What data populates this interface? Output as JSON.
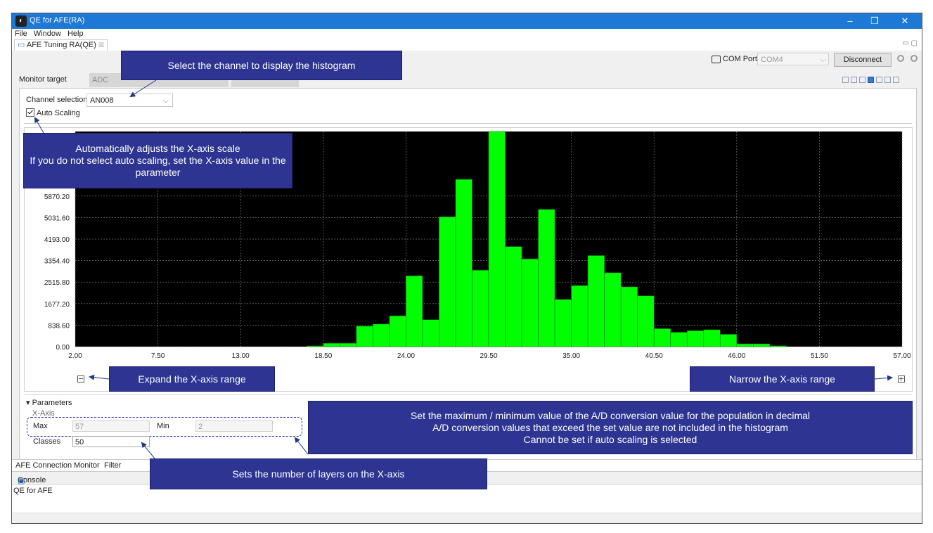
{
  "window": {
    "title": "QE for AFE(RA)",
    "app_icon": "qe-app-icon"
  },
  "menu": [
    "File",
    "Window",
    "Help"
  ],
  "editor_tab": {
    "label": "AFE Tuning RA(QE)",
    "close": "☒"
  },
  "com": {
    "label": "COM Port:",
    "value": "COM4",
    "disconnect_label": "Disconnect"
  },
  "monitor": {
    "label": "Monitor target",
    "target_value": "ADC"
  },
  "channel": {
    "label": "Channel selection",
    "value": "AN008"
  },
  "auto_scaling": {
    "label": "Auto Scaling",
    "checked": true
  },
  "chart_data": {
    "type": "bar",
    "title": "",
    "xlabel": "",
    "ylabel": "",
    "x_ticks": [
      "2.00",
      "7.50",
      "13.00",
      "18.50",
      "24.00",
      "29.50",
      "35.00",
      "40.50",
      "46.00",
      "51.50",
      "57.00"
    ],
    "y_ticks": [
      "0.00",
      "838.60",
      "1677.20",
      "2515.80",
      "3354.40",
      "4193.00",
      "5031.60",
      "5870.20"
    ],
    "xlim": [
      2,
      57
    ],
    "ylim": [
      0,
      8386
    ],
    "bin_width": 1.1,
    "bin_start": 2,
    "values": [
      0,
      0,
      0,
      0,
      0,
      0,
      0,
      0,
      0,
      0,
      0,
      0,
      0,
      0,
      30,
      130,
      130,
      800,
      880,
      1200,
      2760,
      1050,
      5060,
      6520,
      2980,
      8386,
      3900,
      3420,
      5350,
      1840,
      2380,
      3550,
      2880,
      2330,
      1980,
      700,
      560,
      620,
      660,
      480,
      110,
      110,
      35,
      0,
      0,
      0,
      0,
      0,
      0,
      0
    ],
    "bar_color": "#00ff00",
    "background": "#000000",
    "grid": true
  },
  "zoom": {
    "minus_icon": "zoom-out-icon",
    "plus_icon": "zoom-in-icon"
  },
  "params": {
    "heading": "Parameters",
    "xaxis_label": "X-Axis",
    "max_label": "Max",
    "max_value": "57",
    "min_label": "Min",
    "min_value": "2",
    "classes_label": "Classes",
    "classes_value": "50"
  },
  "bottom_tabs": [
    "AFE Connection",
    "Monitor",
    "Filter"
  ],
  "console": {
    "title": "Console",
    "text": "QE for AFE"
  },
  "callouts": {
    "channel": "Select the channel to display the histogram",
    "auto": "Automatically adjusts the X-axis scale\nIf you do not select auto scaling, set the X-axis value in the parameter",
    "expand": "Expand the X-axis range",
    "narrow": "Narrow the X-axis range",
    "maxmin": "Set the maximum / minimum value of the A/D conversion value for the population in decimal\nA/D conversion values that exceed the set value are not included in the histogram\nCannot be set if auto scaling is selected",
    "classes": "Sets the number of layers on the X-axis"
  },
  "colors": {
    "titlebar": "#1e78d6",
    "callout": "#2d3492",
    "bar": "#00ff00"
  }
}
